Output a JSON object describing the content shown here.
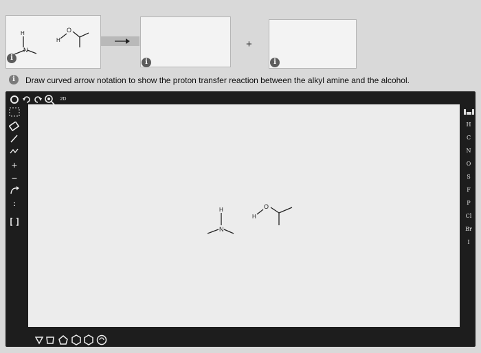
{
  "question": {
    "text": "Draw curved arrow notation to show the proton transfer reaction between the alkyl amine and the alcohol."
  },
  "reaction": {
    "plus": "+",
    "info_glyph": "i"
  },
  "molecules": {
    "amine": {
      "n_label": "N",
      "h_label": "H"
    },
    "alcohol": {
      "o_label": "O",
      "h_label": "H"
    }
  },
  "toolbar": {
    "top_tools": [
      "select-icon",
      "undo-icon",
      "redo-icon",
      "zoom-icon",
      "2d-icon"
    ],
    "zoom_label": "2D",
    "left_tools": [
      "select-tool-icon",
      "eraser-icon",
      "bond-icon",
      "chain-icon",
      "charge-plus-icon",
      "charge-minus-icon",
      "arrow-icon",
      "lone-pair-icon",
      "bracket-icon"
    ],
    "bottom_shapes": [
      "cyclopropane-icon",
      "cyclobutane-icon",
      "cyclopentane-icon",
      "benzene-icon",
      "cyclohexane-icon",
      "cycloheptane-icon"
    ],
    "elements": [
      "H",
      "C",
      "N",
      "O",
      "S",
      "F",
      "P",
      "Cl",
      "Br",
      "I"
    ]
  }
}
